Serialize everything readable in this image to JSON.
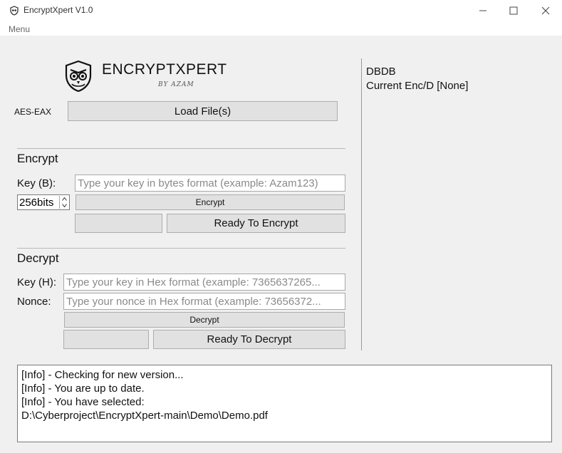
{
  "window": {
    "title": "EncryptXpert V1.0",
    "minimize_label": "—",
    "maximize_label": "☐",
    "close_label": "✕"
  },
  "menu": {
    "items": [
      {
        "label": "Menu"
      }
    ]
  },
  "branding": {
    "name": "ENCRYPTXPERT",
    "tagline": "BY AZAM"
  },
  "mode_label": "AES-EAX",
  "load_button": "Load File(s)",
  "encrypt": {
    "heading": "Encrypt",
    "key_label": "Key (B):",
    "key_placeholder": "Type your key in bytes format (example: Azam123)",
    "key_size": "256bits",
    "encrypt_button": "Encrypt",
    "status_button": "Ready To Encrypt"
  },
  "decrypt": {
    "heading": "Decrypt",
    "key_label": "Key (H):",
    "key_placeholder": "Type your key in Hex format (example: 7365637265...",
    "nonce_label": "Nonce:",
    "nonce_placeholder": "Type your nonce in Hex format (example: 73656372...",
    "decrypt_button": "Decrypt",
    "status_button": "Ready To Decrypt"
  },
  "info_panel": {
    "db_label": "DBDB",
    "current_label": "Current Enc/D  [None]"
  },
  "log": [
    "[Info] - Checking for new version...",
    "[Info] - You are up to date.",
    "[Info] - You have selected:",
    "D:\\Cyberproject\\EncryptXpert-main\\Demo\\Demo.pdf"
  ]
}
